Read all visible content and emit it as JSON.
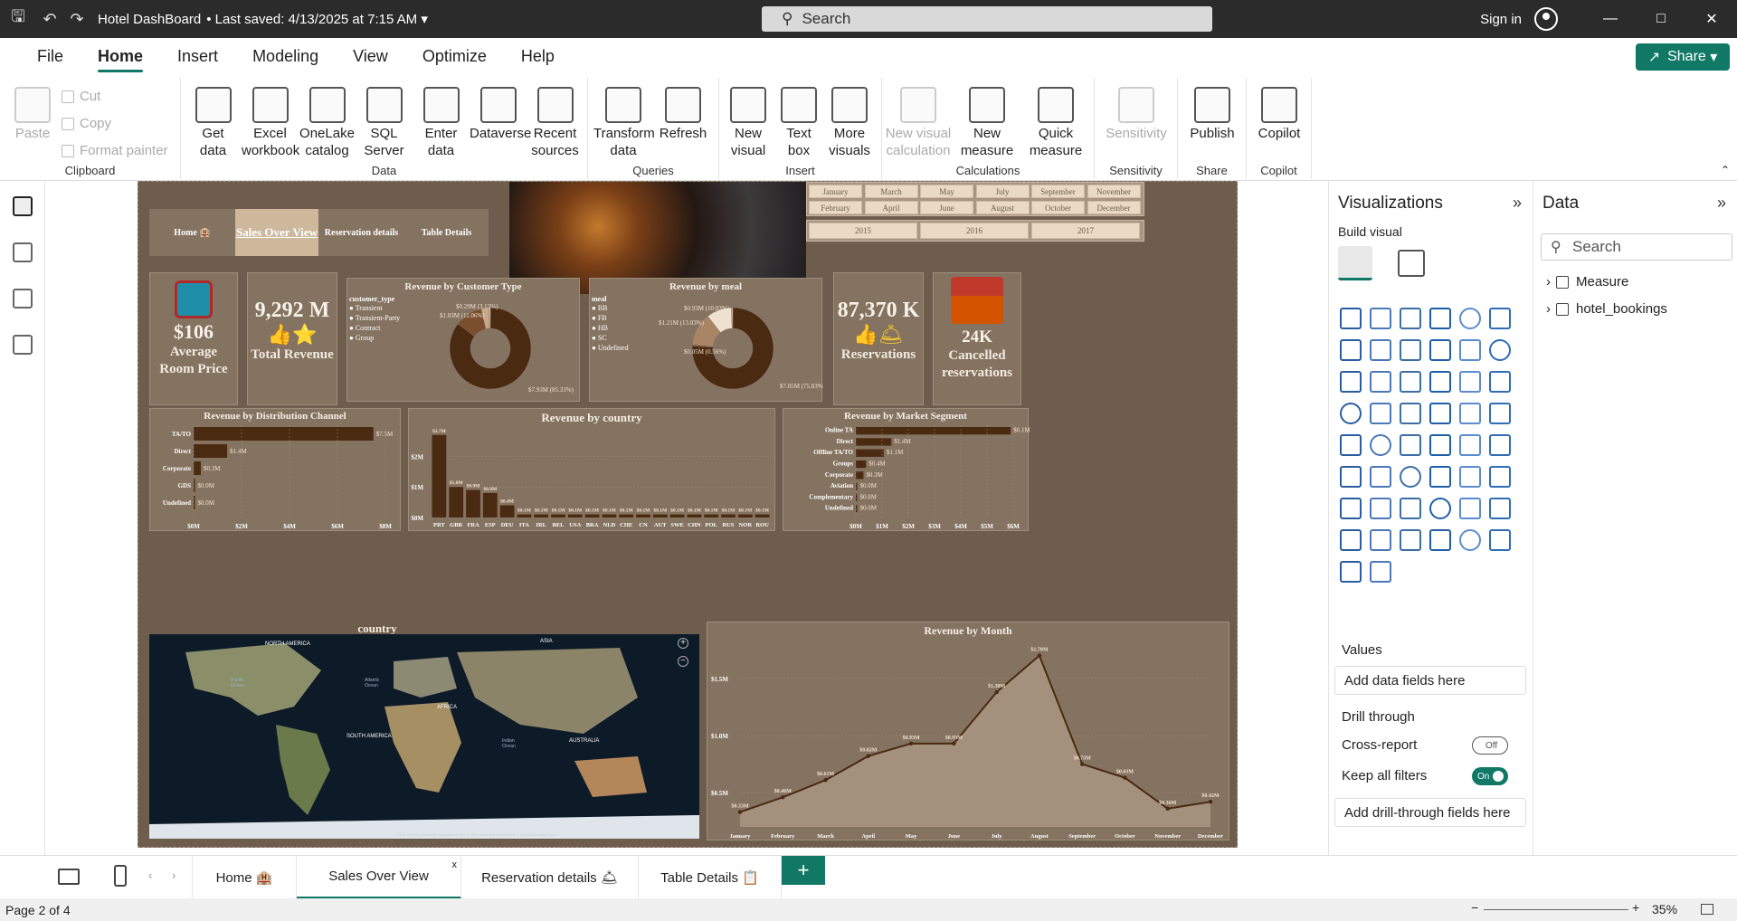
{
  "titlebar": {
    "title": "Hotel DashBoard",
    "saved": "Last saved: 4/13/2025 at 7:15 AM",
    "search_placeholder": "Search",
    "signin": "Sign in"
  },
  "menu": {
    "tabs": [
      "File",
      "Home",
      "Insert",
      "Modeling",
      "View",
      "Optimize",
      "Help"
    ],
    "active": "Home",
    "share": "Share"
  },
  "ribbon": {
    "clipboard": {
      "label": "Clipboard",
      "paste": "Paste",
      "cut": "Cut",
      "copy": "Copy",
      "format_painter": "Format painter"
    },
    "data": {
      "label": "Data",
      "buttons": [
        [
          "Get",
          "data"
        ],
        [
          "Excel",
          "workbook"
        ],
        [
          "OneLake",
          "catalog"
        ],
        [
          "SQL",
          "Server"
        ],
        [
          "Enter",
          "data"
        ],
        [
          "Dataverse",
          ""
        ],
        [
          "Recent",
          "sources"
        ]
      ]
    },
    "queries": {
      "label": "Queries",
      "buttons": [
        [
          "Transform",
          "data"
        ],
        [
          "Refresh",
          ""
        ]
      ]
    },
    "insert": {
      "label": "Insert",
      "buttons": [
        [
          "New",
          "visual"
        ],
        [
          "Text",
          "box"
        ],
        [
          "More",
          "visuals"
        ]
      ]
    },
    "calculations": {
      "label": "Calculations",
      "buttons": [
        [
          "New visual",
          "calculation"
        ],
        [
          "New",
          "measure"
        ],
        [
          "Quick",
          "measure"
        ]
      ]
    },
    "sensitivity": {
      "label": "Sensitivity",
      "buttons": [
        [
          "Sensitivity",
          ""
        ]
      ]
    },
    "share": {
      "label": "Share",
      "buttons": [
        [
          "Publish",
          ""
        ]
      ]
    },
    "copilot": {
      "label": "Copilot",
      "buttons": [
        [
          "Copilot",
          ""
        ]
      ]
    }
  },
  "report": {
    "nav": {
      "home": "Home",
      "sales": "Sales Over View",
      "reservation": "Reservation details",
      "table": "Table Details"
    },
    "months": [
      "January",
      "March",
      "May",
      "July",
      "September",
      "November",
      "February",
      "April",
      "June",
      "August",
      "October",
      "December"
    ],
    "years": [
      "2015",
      "2016",
      "2017"
    ],
    "kpis": {
      "avg_room_price": {
        "value": "$106",
        "label": "Average Room Price"
      },
      "total_revenue": {
        "value": "9,292 M",
        "label": "Total Revenue"
      },
      "reservations": {
        "value": "87,370 K",
        "label": "Reservations"
      },
      "cancelled": {
        "value": "24K",
        "label": "Cancelled reservations"
      }
    },
    "map_title": "country",
    "map_labels": {
      "north_america": "NORTH AMERICA",
      "asia": "ASIA",
      "africa": "AFRICA",
      "south_america": "SOUTH AMERICA",
      "australia": "AUSTRALIA",
      "pacific": "Pacific Ocean",
      "atlantic": "Atlantic Ocean",
      "indian": "Indian Ocean",
      "attribution": "© 2025 TomTom, Earthstar Geographics SIO, © 2025 Microsoft Corporation, © OpenStreetMap  Terms"
    }
  },
  "chart_data": [
    {
      "type": "pie",
      "title": "Revenue by Customer Type",
      "legend_title": "customer_type",
      "categories": [
        "Transient",
        "Transient-Party",
        "Contract",
        "Group"
      ],
      "values": [
        7.93,
        1.03,
        0.29,
        0.05
      ],
      "labels": [
        "$7.93M (85.33%)",
        "$1.03M (11.06%)",
        "$0.29M (3.13%)",
        ""
      ],
      "colors": [
        "#4a2a10",
        "#7a4f2e",
        "#c7a88a",
        "#efe1cf"
      ]
    },
    {
      "type": "pie",
      "title": "Revenue by meal",
      "legend_title": "meal",
      "categories": [
        "BB",
        "FB",
        "HB",
        "SC",
        "Undefined"
      ],
      "values": [
        7.05,
        0.05,
        1.21,
        0.93,
        0.05
      ],
      "labels": [
        "$7.05M (75.83%)",
        "",
        "$1.21M (13.03%)",
        "$0.93M (10.03%)",
        "$0.05M (0.56%)"
      ],
      "colors": [
        "#4a2a10",
        "#6b4426",
        "#a98566",
        "#efe1cf",
        "#d5bca0"
      ]
    },
    {
      "type": "bar",
      "orientation": "horizontal",
      "title": "Revenue by Distribution Channel",
      "categories": [
        "TA/TO",
        "Direct",
        "Corporate",
        "GDS",
        "Undefined"
      ],
      "values": [
        7.5,
        1.4,
        0.3,
        0.0,
        0.0
      ],
      "labels": [
        "$7.5M",
        "$1.4M",
        "$0.3M",
        "$0.0M",
        "$0.0M"
      ],
      "xticks": [
        "$0M",
        "$2M",
        "$4M",
        "$6M",
        "$8M"
      ],
      "xlim": [
        0,
        8
      ]
    },
    {
      "type": "bar",
      "title": "Revenue by country",
      "categories": [
        "PRT",
        "GBR",
        "FRA",
        "ESP",
        "DEU",
        "ITA",
        "IRL",
        "BEL",
        "USA",
        "BRA",
        "NLD",
        "CHE",
        "CN",
        "AUT",
        "SWE",
        "CHN",
        "POL",
        "RUS",
        "NOR",
        "ROU"
      ],
      "values": [
        2.7,
        1.0,
        0.9,
        0.8,
        0.4,
        0.1,
        0.1,
        0.1,
        0.1,
        0.1,
        0.1,
        0.1,
        0.1,
        0.1,
        0.1,
        0.1,
        0.1,
        0.1,
        0.1,
        0.1
      ],
      "labels": [
        "$2.7M",
        "$1.0M",
        "$0.9M",
        "$0.8M",
        "$0.4M",
        "$0.1M",
        "$0.1M",
        "$0.1M",
        "$0.1M",
        "$0.1M",
        "$0.1M",
        "$0.1M",
        "$0.1M",
        "$0.1M",
        "$0.1M",
        "$0.1M",
        "$0.1M",
        "$0.1M",
        "$0.1M",
        "$0.1M"
      ],
      "yticks": [
        "$0M",
        "$1M",
        "$2M"
      ],
      "ylim": [
        0,
        2.9
      ]
    },
    {
      "type": "bar",
      "orientation": "horizontal",
      "title": "Revenue by Market Segment",
      "categories": [
        "Online TA",
        "Direct",
        "Offline TA/TO",
        "Groups",
        "Corporate",
        "Aviation",
        "Complementary",
        "Undefined"
      ],
      "values": [
        6.1,
        1.4,
        1.1,
        0.4,
        0.3,
        0.0,
        0.0,
        0.0
      ],
      "labels": [
        "$6.1M",
        "$1.4M",
        "$1.1M",
        "$0.4M",
        "$0.3M",
        "$0.0M",
        "$0.0M",
        "$0.0M"
      ],
      "xticks": [
        "$0M",
        "$1M",
        "$2M",
        "$3M",
        "$4M",
        "$5M",
        "$6M"
      ],
      "xlim": [
        0,
        6.2
      ]
    },
    {
      "type": "area",
      "title": "Revenue by Month",
      "categories": [
        "January",
        "February",
        "March",
        "April",
        "May",
        "June",
        "July",
        "August",
        "September",
        "October",
        "November",
        "December"
      ],
      "values": [
        0.33,
        0.46,
        0.61,
        0.82,
        0.93,
        0.93,
        1.38,
        1.7,
        0.75,
        0.63,
        0.36,
        0.42
      ],
      "labels": [
        "$0.33M",
        "$0.46M",
        "$0.61M",
        "$0.82M",
        "$0.93M",
        "$0.93M",
        "$1.38M",
        "$1.70M",
        "$0.75M",
        "$0.63M",
        "$0.36M",
        "$0.42M"
      ],
      "yticks": [
        "$0.5M",
        "$1.0M",
        "$1.5M"
      ],
      "ylim": [
        0.2,
        1.8
      ]
    }
  ],
  "viz_pane": {
    "title": "Visualizations",
    "build_visual": "Build visual",
    "values": "Values",
    "add_data": "Add data fields here",
    "drill_through": "Drill through",
    "cross_report": "Cross-report",
    "cross_report_state": "Off",
    "keep_filters": "Keep all filters",
    "keep_filters_state": "On",
    "add_drill": "Add drill-through fields here",
    "accent": "#117865"
  },
  "data_pane": {
    "title": "Data",
    "search_placeholder": "Search",
    "items": [
      "Measure",
      "hotel_bookings"
    ]
  },
  "page_tabs": [
    "Home",
    "Sales Over View",
    "Reservation details",
    "Table Details"
  ],
  "status": {
    "page": "Page 2 of 4",
    "zoom": "35%"
  }
}
